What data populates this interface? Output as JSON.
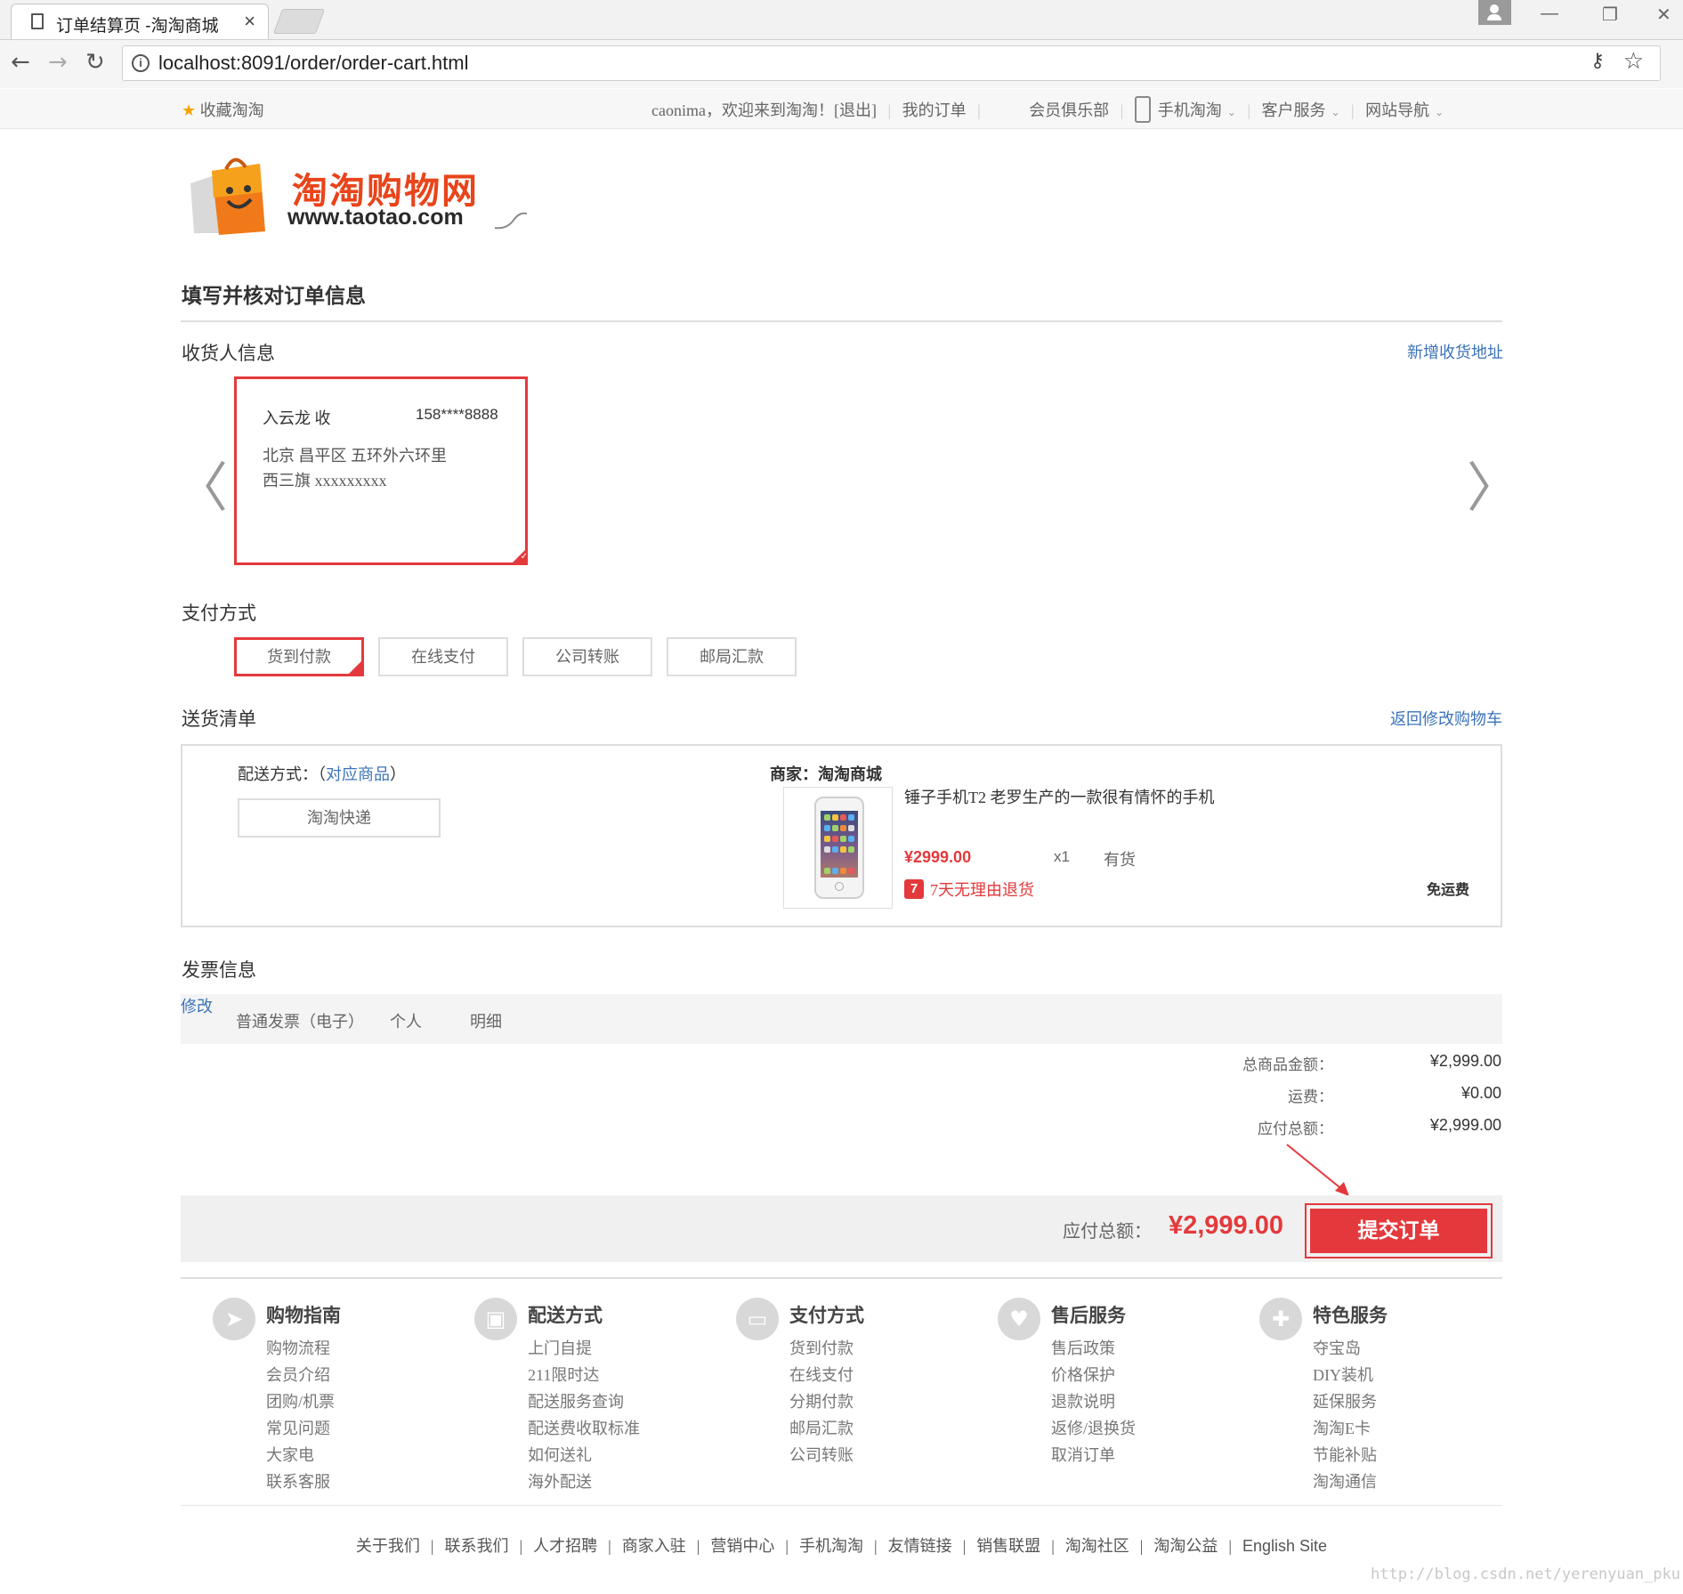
{
  "browser": {
    "tab_title": "订单结算页 -淘淘商城",
    "tab_close": "×",
    "url": "localhost:8091/order/order-cart.html",
    "back_icon": "←",
    "forward_icon": "→",
    "reload_icon": "↻",
    "key_icon": "⚷",
    "star_icon": "☆",
    "minimize": "—",
    "restore": "❐",
    "close": "✕"
  },
  "topbar": {
    "favorite": "收藏淘淘",
    "welcome": "caonima，欢迎来到淘淘！[退出]",
    "my_orders": "我的订单",
    "club": "会员俱乐部",
    "mobile": "手机淘淘",
    "service": "客户服务",
    "nav": "网站导航"
  },
  "logo": {
    "cn": "淘淘购物网",
    "en": "www.taotao.com"
  },
  "page_title": "填写并核对订单信息",
  "consignee": {
    "title": "收货人信息",
    "add_link": "新增收货地址",
    "name": "入云龙  收",
    "phone": "158****8888",
    "address_line1": "北京 昌平区 五环外六环里",
    "address_line2": "西三旗 xxxxxxxxx",
    "prev_icon": "〈",
    "next_icon": "〉"
  },
  "payment": {
    "title": "支付方式",
    "options": [
      "货到付款",
      "在线支付",
      "公司转账",
      "邮局汇款"
    ],
    "selected": "货到付款"
  },
  "delivery": {
    "title": "送货清单",
    "back_link": "返回修改购物车",
    "method_label": "配送方式：（",
    "method_link": "对应商品",
    "method_close": "）",
    "express": "淘淘快递",
    "merchant": "商家：淘淘商城",
    "product_name": "锤子手机T2 老罗生产的一款很有情怀的手机",
    "price": "¥2999.00",
    "qty": "x1",
    "stock": "有货",
    "return_badge": "7",
    "return_text": "7天无理由退货",
    "free_shipping": "免运费"
  },
  "invoice": {
    "title": "发票信息",
    "type": "普通发票（电子）",
    "owner": "个人",
    "detail": "明细",
    "edit": "修改"
  },
  "summary": {
    "goods_label": "总商品金额：",
    "goods_value": "¥2,999.00",
    "freight_label": "运费：",
    "freight_value": "¥0.00",
    "payable_label": "应付总额：",
    "payable_value": "¥2,999.00"
  },
  "checkout": {
    "label": "应付总额：",
    "total": "¥2,999.00",
    "submit": "提交订单"
  },
  "footer": {
    "columns": [
      {
        "title": "购物指南",
        "icon": "compass-icon",
        "glyph": "➤",
        "items": [
          "购物流程",
          "会员介绍",
          "团购/机票",
          "常见问题",
          "大家电",
          "联系客服"
        ]
      },
      {
        "title": "配送方式",
        "icon": "bus-icon",
        "glyph": "▣",
        "items": [
          "上门自提",
          "211限时达",
          "配送服务查询",
          "配送费收取标准",
          "如何送礼",
          "海外配送"
        ]
      },
      {
        "title": "支付方式",
        "icon": "wallet-icon",
        "glyph": "▭",
        "items": [
          "货到付款",
          "在线支付",
          "分期付款",
          "邮局汇款",
          "公司转账"
        ]
      },
      {
        "title": "售后服务",
        "icon": "heart-icon",
        "glyph": "♥",
        "items": [
          "售后政策",
          "价格保护",
          "退款说明",
          "返修/退换货",
          "取消订单"
        ]
      },
      {
        "title": "特色服务",
        "icon": "wrench-icon",
        "glyph": "✚",
        "items": [
          "夺宝岛",
          "DIY装机",
          "延保服务",
          "淘淘E卡",
          "节能补贴",
          "淘淘通信"
        ]
      }
    ],
    "links": [
      "关于我们",
      "联系我们",
      "人才招聘",
      "商家入驻",
      "营销中心",
      "手机淘淘",
      "友情链接",
      "销售联盟",
      "淘淘社区",
      "淘淘公益",
      "English Site"
    ],
    "separator": "|"
  },
  "watermark": "http://blog.csdn.net/yerenyuan_pku",
  "colors": {
    "accent": "#e4393c",
    "link": "#3b73b9"
  }
}
